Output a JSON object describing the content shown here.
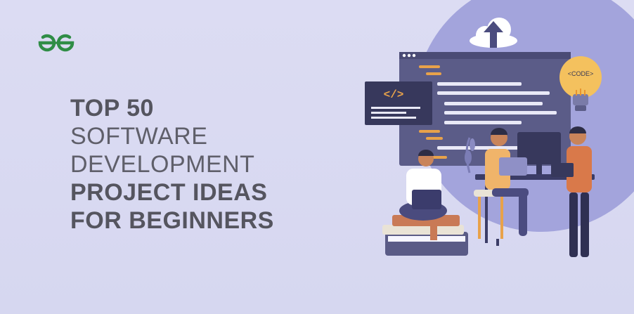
{
  "brand": {
    "logo_icon": "geeksforgeeks-logo-icon",
    "logo_color": "#2f8d46"
  },
  "headline": {
    "line1": "TOP 50",
    "line2": "SOFTWARE",
    "line3": "DEVELOPMENT",
    "line4": "PROJECT IDEAS",
    "line5": "FOR BEGINNERS"
  },
  "illustration": {
    "code_tag": "</>",
    "bulb_label": "<CODE>",
    "icons": [
      "cloud-upload-icon",
      "code-editor-icon",
      "lightbulb-icon",
      "laptop-icon",
      "monitor-icon",
      "books-icon"
    ]
  },
  "colors": {
    "background": "#d8d8f0",
    "circle": "#9c9dd8",
    "panel": "#5a5b86",
    "panel_dark": "#36375a",
    "accent_orange": "#e8a24a",
    "skin": "#c9845a"
  }
}
